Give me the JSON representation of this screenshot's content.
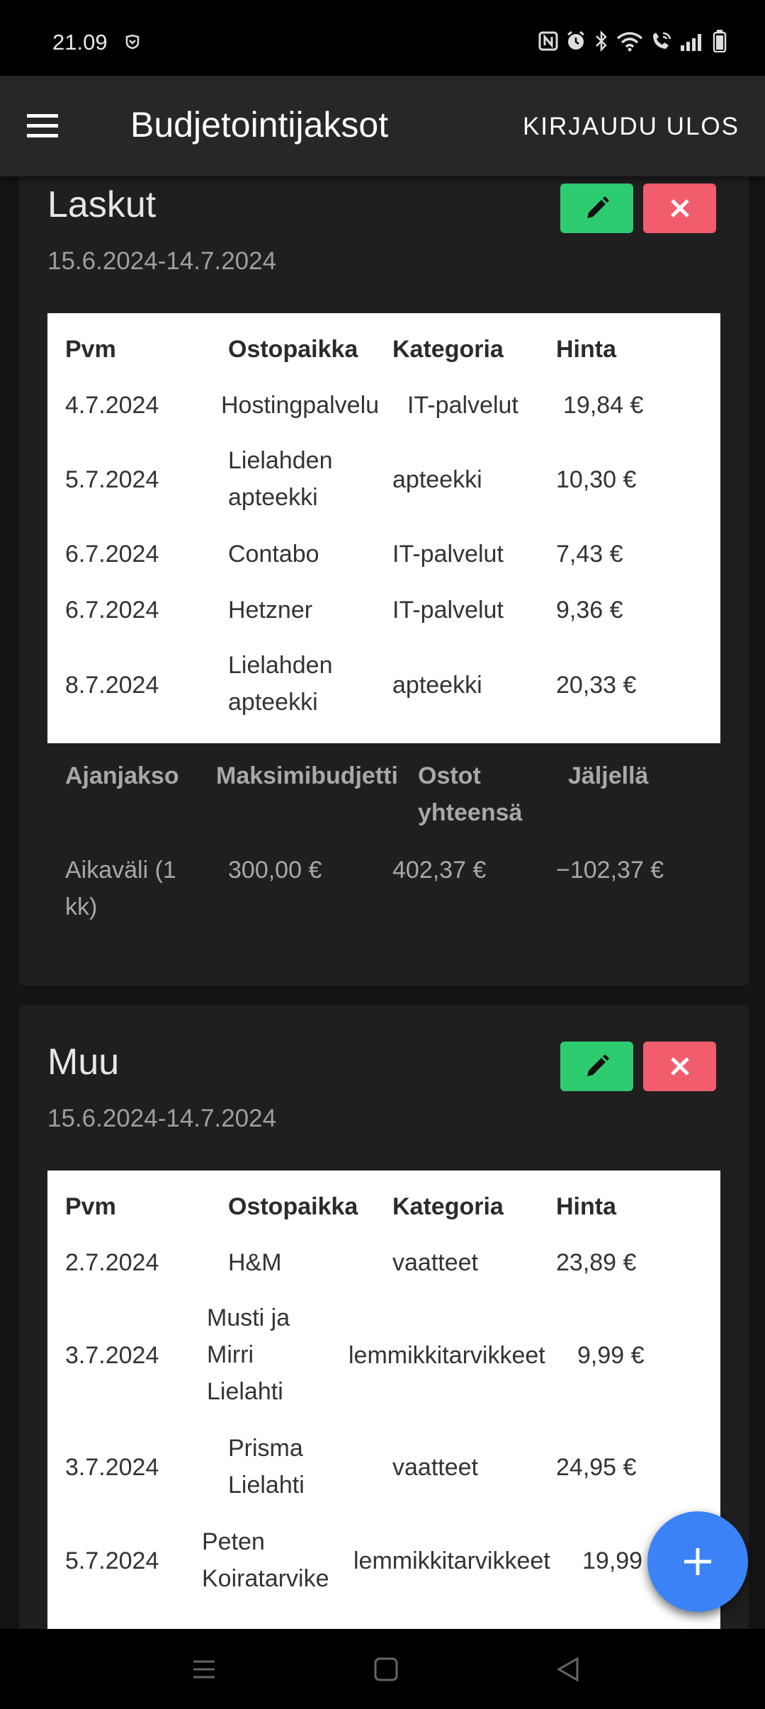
{
  "status_bar": {
    "time": "21.09"
  },
  "app_bar": {
    "title": "Budjetointijaksot",
    "logout_label": "KIRJAUDU ULOS"
  },
  "cards": [
    {
      "title": "Laskut",
      "dates": "15.6.2024-14.7.2024",
      "headers": [
        "Pvm",
        "Ostopaikka",
        "Kategoria",
        "Hinta"
      ],
      "rows": [
        [
          "4.7.2024",
          "Hostingpalvelu",
          "IT-palvelut",
          "19,84 €"
        ],
        [
          "5.7.2024",
          "Lielahden\napteekki",
          "apteekki",
          "10,30 €"
        ],
        [
          "6.7.2024",
          "Contabo",
          "IT-palvelut",
          "7,43 €"
        ],
        [
          "6.7.2024",
          "Hetzner",
          "IT-palvelut",
          "9,36 €"
        ],
        [
          "8.7.2024",
          "Lielahden\napteekki",
          "apteekki",
          "20,33 €"
        ]
      ],
      "summary_headers": [
        "Ajanjakso",
        "Maksimibudjetti",
        "Ostot\nyhteensä",
        "Jäljellä"
      ],
      "summary_row": [
        "Aikaväli (1\nkk)",
        "300,00 €",
        "402,37 €",
        "−102,37 €"
      ]
    },
    {
      "title": "Muu",
      "dates": "15.6.2024-14.7.2024",
      "headers": [
        "Pvm",
        "Ostopaikka",
        "Kategoria",
        "Hinta"
      ],
      "rows": [
        [
          "2.7.2024",
          "H&M",
          "vaatteet",
          "23,89 €"
        ],
        [
          "3.7.2024",
          "Musti ja\nMirri\nLielahti",
          "lemmikkitarvikkeet",
          "9,99 €"
        ],
        [
          "3.7.2024",
          "Prisma\nLielahti",
          "vaatteet",
          "24,95 €"
        ],
        [
          "5.7.2024",
          "Peten\nKoiratarvike",
          "lemmikkitarvikkeet",
          "19,99"
        ]
      ]
    }
  ],
  "icons": {
    "menu": "menu-icon",
    "edit": "pencil-icon",
    "delete": "close-icon",
    "add": "plus-icon",
    "nav_recents": "recents-icon",
    "nav_home": "home-icon",
    "nav_back": "back-icon"
  },
  "colors": {
    "edit_button": "#2ecc71",
    "delete_button": "#f25d6e",
    "fab": "#3b82f6",
    "app_bar": "#272727",
    "card": "#1f1f1f"
  }
}
